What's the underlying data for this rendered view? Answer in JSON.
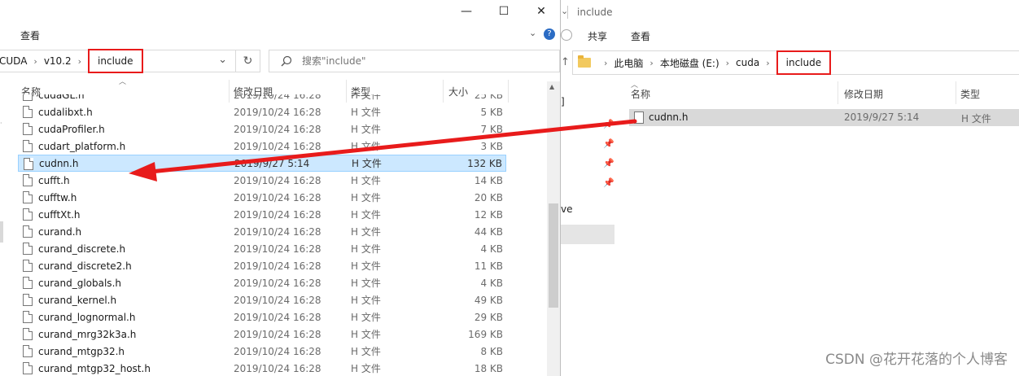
{
  "left_window": {
    "controls": {
      "minimize": "—",
      "maximize": "☐",
      "close": "✕"
    },
    "ribbon": {
      "view_tab": "查看",
      "expand_chevron": "⌄",
      "help_icon": "?"
    },
    "breadcrumb": {
      "parent2": "CUDA",
      "parent1": "v10.2",
      "current": "include"
    },
    "dropdown_chevron": "⌄",
    "refresh_glyph": "↻",
    "search": {
      "placeholder": "搜索\"include\"",
      "icon": "search-icon"
    },
    "columns": {
      "name": "名称",
      "date": "修改日期",
      "type": "类型",
      "size": "大小"
    },
    "files": [
      {
        "name": "cudaGL.h",
        "date": "2019/10/24 16:28",
        "type": "H 文件",
        "size": "25 KB"
      },
      {
        "name": "cudalibxt.h",
        "date": "2019/10/24 16:28",
        "type": "H 文件",
        "size": "5 KB"
      },
      {
        "name": "cudaProfiler.h",
        "date": "2019/10/24 16:28",
        "type": "H 文件",
        "size": "7 KB"
      },
      {
        "name": "cudart_platform.h",
        "date": "2019/10/24 16:28",
        "type": "H 文件",
        "size": "3 KB"
      },
      {
        "name": "cudnn.h",
        "date": "2019/9/27 5:14",
        "type": "H 文件",
        "size": "132 KB",
        "selected": true
      },
      {
        "name": "cufft.h",
        "date": "2019/10/24 16:28",
        "type": "H 文件",
        "size": "14 KB"
      },
      {
        "name": "cufftw.h",
        "date": "2019/10/24 16:28",
        "type": "H 文件",
        "size": "20 KB"
      },
      {
        "name": "cufftXt.h",
        "date": "2019/10/24 16:28",
        "type": "H 文件",
        "size": "12 KB"
      },
      {
        "name": "curand.h",
        "date": "2019/10/24 16:28",
        "type": "H 文件",
        "size": "44 KB"
      },
      {
        "name": "curand_discrete.h",
        "date": "2019/10/24 16:28",
        "type": "H 文件",
        "size": "4 KB"
      },
      {
        "name": "curand_discrete2.h",
        "date": "2019/10/24 16:28",
        "type": "H 文件",
        "size": "11 KB"
      },
      {
        "name": "curand_globals.h",
        "date": "2019/10/24 16:28",
        "type": "H 文件",
        "size": "4 KB"
      },
      {
        "name": "curand_kernel.h",
        "date": "2019/10/24 16:28",
        "type": "H 文件",
        "size": "49 KB"
      },
      {
        "name": "curand_lognormal.h",
        "date": "2019/10/24 16:28",
        "type": "H 文件",
        "size": "29 KB"
      },
      {
        "name": "curand_mrg32k3a.h",
        "date": "2019/10/24 16:28",
        "type": "H 文件",
        "size": "169 KB"
      },
      {
        "name": "curand_mtgp32.h",
        "date": "2019/10/24 16:28",
        "type": "H 文件",
        "size": "8 KB"
      },
      {
        "name": "curand_mtgp32_host.h",
        "date": "2019/10/24 16:28",
        "type": "H 文件",
        "size": "18 KB"
      }
    ]
  },
  "right_window": {
    "title": "include",
    "ribbon": {
      "share_tab": "共享",
      "view_tab": "查看"
    },
    "breadcrumb": {
      "pc": "此电脑",
      "disk": "本地磁盘 (E:)",
      "folder": "cuda",
      "current": "include"
    },
    "up_arrow": "↑",
    "nav_fragments": {
      "bracket": "]",
      "partial_text": "ve"
    },
    "columns": {
      "name": "名称",
      "date": "修改日期",
      "type": "类型"
    },
    "files": [
      {
        "name": "cudnn.h",
        "date": "2019/9/27 5:14",
        "type": "H 文件"
      }
    ]
  },
  "annotation": {
    "highlight_color": "#e81b1b",
    "arrow_color": "#e81b1b"
  },
  "watermark": "CSDN @花开花落的个人博客",
  "colors": {
    "selection_bg": "#cce8ff",
    "selection_border": "#99d1ff",
    "hover_bg": "#d9d9d9",
    "folder": "#f2c95e"
  }
}
